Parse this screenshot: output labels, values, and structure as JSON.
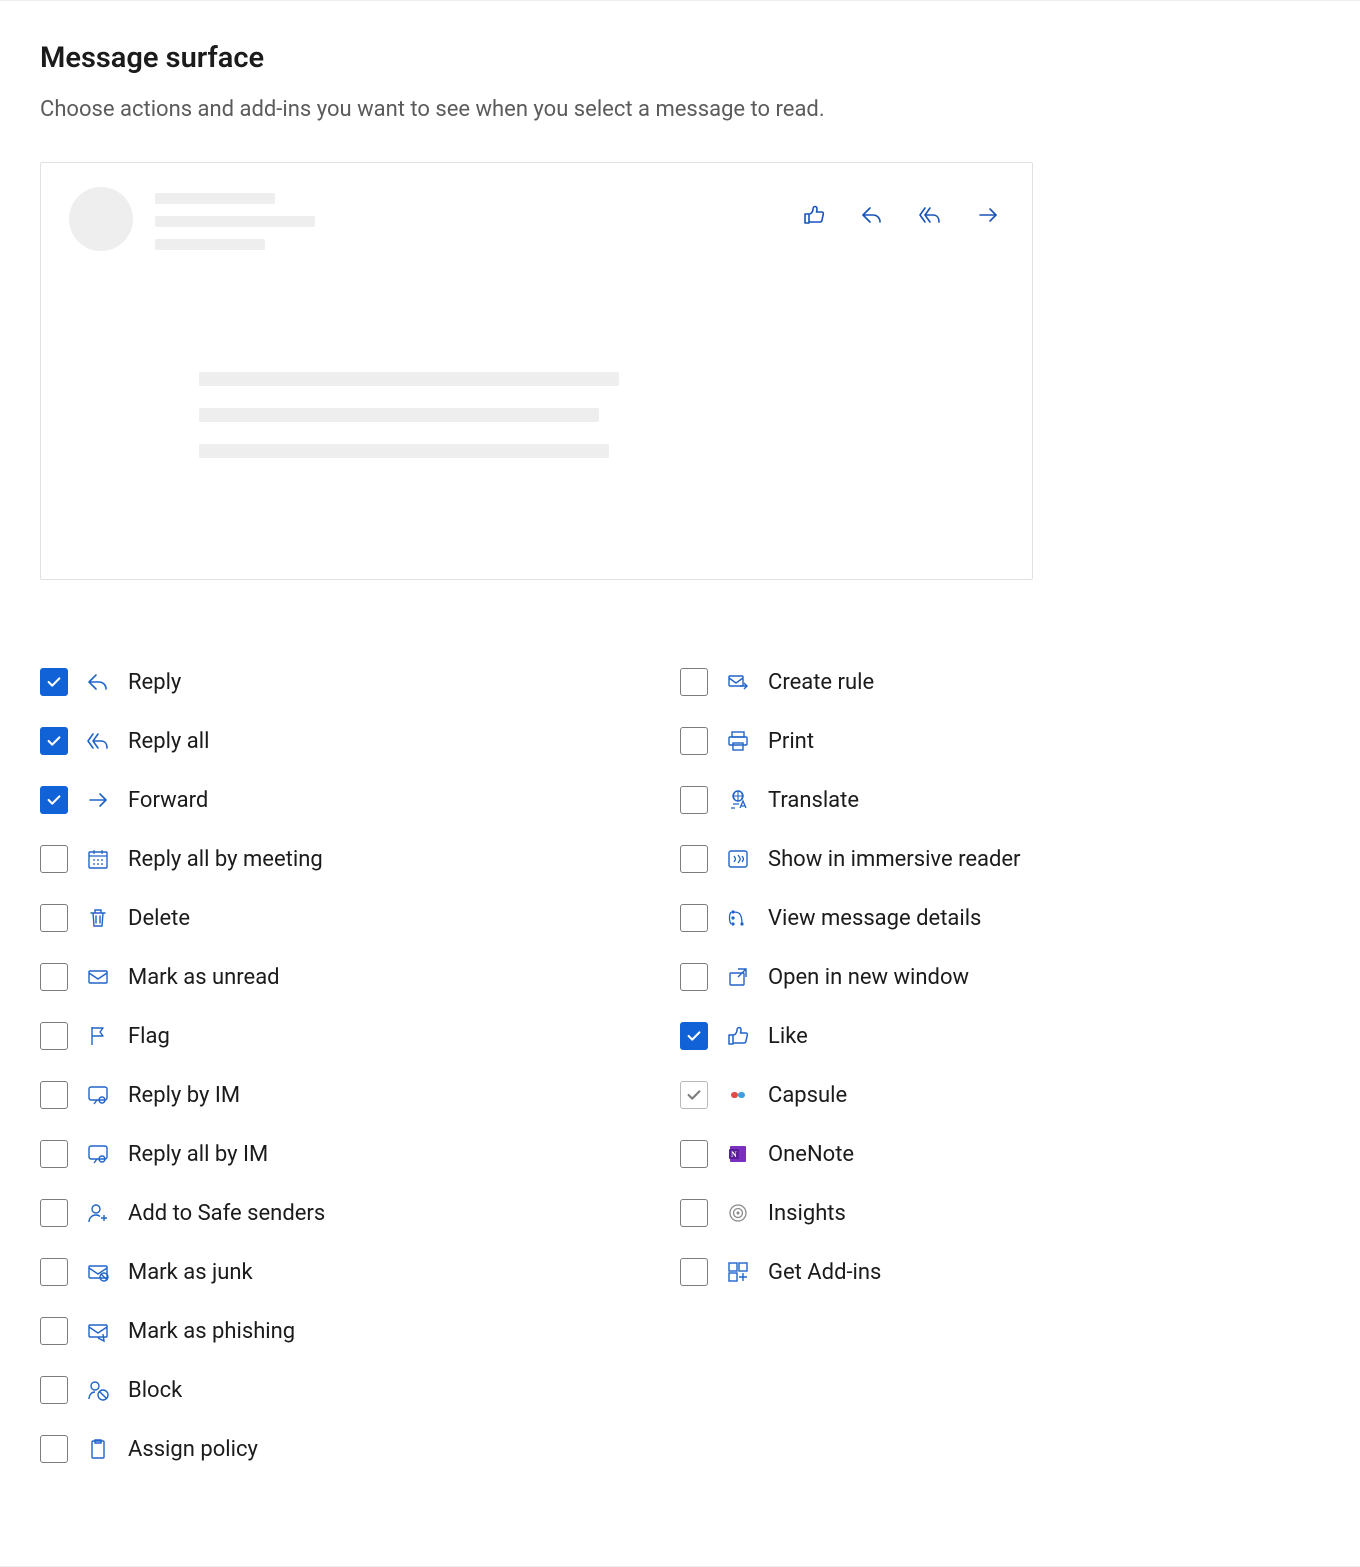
{
  "heading": "Message surface",
  "description": "Choose actions and add-ins you want to see when you select a message to read.",
  "left_column": [
    {
      "id": "reply",
      "label": "Reply",
      "checked": true,
      "locked": false
    },
    {
      "id": "reply-all",
      "label": "Reply all",
      "checked": true,
      "locked": false
    },
    {
      "id": "forward",
      "label": "Forward",
      "checked": true,
      "locked": false
    },
    {
      "id": "reply-all-meeting",
      "label": "Reply all by meeting",
      "checked": false,
      "locked": false
    },
    {
      "id": "delete",
      "label": "Delete",
      "checked": false,
      "locked": false
    },
    {
      "id": "mark-unread",
      "label": "Mark as unread",
      "checked": false,
      "locked": false
    },
    {
      "id": "flag",
      "label": "Flag",
      "checked": false,
      "locked": false
    },
    {
      "id": "reply-im",
      "label": "Reply by IM",
      "checked": false,
      "locked": false
    },
    {
      "id": "reply-all-im",
      "label": "Reply all by IM",
      "checked": false,
      "locked": false
    },
    {
      "id": "safe-senders",
      "label": "Add to Safe senders",
      "checked": false,
      "locked": false
    },
    {
      "id": "mark-junk",
      "label": "Mark as junk",
      "checked": false,
      "locked": false
    },
    {
      "id": "mark-phishing",
      "label": "Mark as phishing",
      "checked": false,
      "locked": false
    },
    {
      "id": "block",
      "label": "Block",
      "checked": false,
      "locked": false
    },
    {
      "id": "assign-policy",
      "label": "Assign policy",
      "checked": false,
      "locked": false
    }
  ],
  "right_column": [
    {
      "id": "create-rule",
      "label": "Create rule",
      "checked": false,
      "locked": false
    },
    {
      "id": "print",
      "label": "Print",
      "checked": false,
      "locked": false
    },
    {
      "id": "translate",
      "label": "Translate",
      "checked": false,
      "locked": false
    },
    {
      "id": "immersive-reader",
      "label": "Show in immersive reader",
      "checked": false,
      "locked": false
    },
    {
      "id": "message-details",
      "label": "View message details",
      "checked": false,
      "locked": false
    },
    {
      "id": "new-window",
      "label": "Open in new window",
      "checked": false,
      "locked": false
    },
    {
      "id": "like",
      "label": "Like",
      "checked": true,
      "locked": false
    },
    {
      "id": "capsule",
      "label": "Capsule",
      "checked": true,
      "locked": true
    },
    {
      "id": "onenote",
      "label": "OneNote",
      "checked": false,
      "locked": false
    },
    {
      "id": "insights",
      "label": "Insights",
      "checked": false,
      "locked": false
    },
    {
      "id": "get-addins",
      "label": "Get Add-ins",
      "checked": false,
      "locked": false
    }
  ]
}
